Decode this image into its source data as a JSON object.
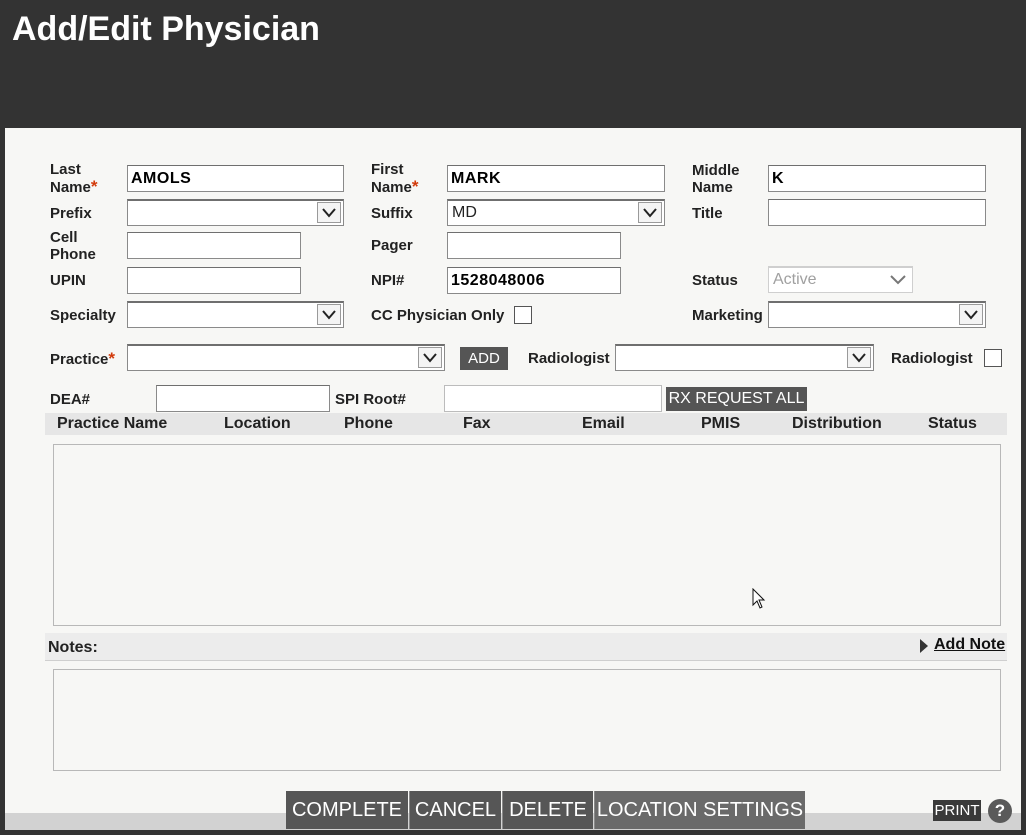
{
  "header": {
    "title": "Add/Edit Physician"
  },
  "form": {
    "last_name_label": "Last Name",
    "last_name_value": "AMOLS",
    "first_name_label": "First Name",
    "first_name_value": "MARK",
    "middle_name_label": "Middle Name",
    "middle_name_value": "K",
    "prefix_label": "Prefix",
    "prefix_value": "",
    "suffix_label": "Suffix",
    "suffix_value": "MD",
    "title_label": "Title",
    "title_value": "",
    "cell_phone_label": "Cell Phone",
    "cell_phone_value": "",
    "pager_label": "Pager",
    "pager_value": "",
    "upin_label": "UPIN",
    "upin_value": "",
    "npi_label": "NPI#",
    "npi_value": "1528048006",
    "status_label": "Status",
    "status_value": "Active",
    "specialty_label": "Specialty",
    "specialty_value": "",
    "cc_physician_only_label": "CC Physician Only",
    "cc_physician_only_checked": false,
    "marketing_label": "Marketing",
    "marketing_value": "",
    "practice_label": "Practice",
    "practice_value": "",
    "add_button": "ADD",
    "radiologist_select_label": "Radiologist",
    "radiologist_select_value": "",
    "radiologist_check_label": "Radiologist",
    "radiologist_checked": false,
    "dea_label": "DEA#",
    "dea_value": "",
    "spi_root_label": "SPI Root#",
    "spi_root_value": "",
    "rx_request_button": "RX REQUEST ALL",
    "required_mark": "*"
  },
  "practice_table": {
    "columns": [
      "Practice Name",
      "Location",
      "Phone",
      "Fax",
      "Email",
      "PMIS",
      "Distribution",
      "Status"
    ],
    "rows": []
  },
  "notes": {
    "label": "Notes:",
    "add_note_link": "Add Note"
  },
  "footer": {
    "complete": "COMPLETE",
    "cancel": "CANCEL",
    "delete": "DELETE",
    "location_settings": "LOCATION SETTINGS",
    "print": "PRINT",
    "help": "?"
  },
  "colors": {
    "header_bg": "#333333",
    "panel_bg": "#f7f7f5",
    "required": "#d23a0a",
    "button_bg": "#565656"
  }
}
